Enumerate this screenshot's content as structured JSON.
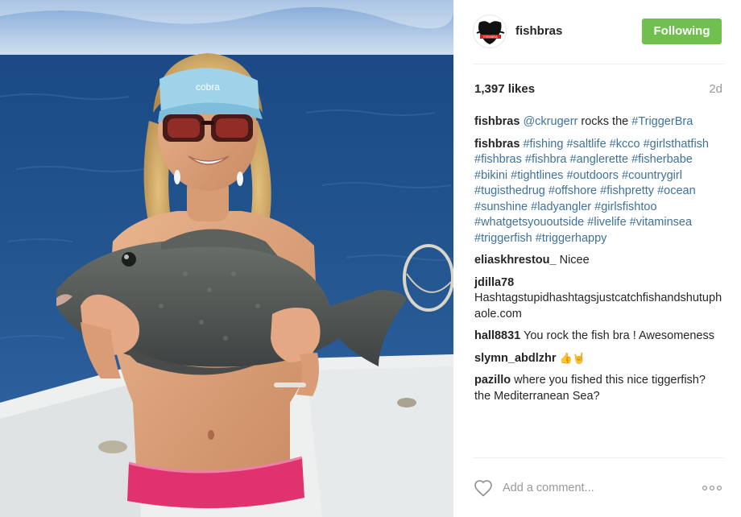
{
  "post": {
    "username": "fishbras",
    "follow_button": "Following",
    "likes": "1,397 likes",
    "time": "2d",
    "caption": {
      "user": "fishbras",
      "parts": [
        {
          "text": "@ckrugerr",
          "link": true
        },
        {
          "text": " rocks the ",
          "link": false
        },
        {
          "text": "#TriggerBra",
          "link": true
        }
      ]
    },
    "hashtag_comment": {
      "user": "fishbras",
      "tags": [
        "#fishing",
        "#saltlife",
        "#kcco",
        "#girlsthatfish",
        "#fishbras",
        "#fishbra",
        "#anglerette",
        "#fisherbabe",
        "#bikini",
        "#tightlines",
        "#outdoors",
        "#countrygirl",
        "#tugisthedrug",
        "#offshore",
        "#fishpretty",
        "#ocean",
        "#sunshine",
        "#ladyangler",
        "#girlsfishtoo",
        "#whatgetsyououtside",
        "#livelife",
        "#vitaminsea",
        "#triggerfish",
        "#triggerhappy"
      ]
    },
    "comments": [
      {
        "user": "eliaskhrestou_",
        "text": "Nicee"
      },
      {
        "user": "jdilla78",
        "text": "Hashtagstupidhashtagsjustcatchfishandshutuphaole.com"
      },
      {
        "user": "hall8831",
        "text": "You rock the fish bra ! Awesomeness"
      },
      {
        "user": "slymn_abdlzhr",
        "text": "👍🤘",
        "emoji": true
      },
      {
        "user": "pazillo",
        "text": "where you fished this nice tiggerfish? the Mediterranean Sea?"
      }
    ],
    "add_comment_placeholder": "Add a comment...",
    "icons": {
      "like": "heart-icon",
      "more": "more-options-icon",
      "avatar": "fishbras-logo"
    },
    "colors": {
      "follow": "#70c050",
      "link": "#3f729b",
      "muted": "#999999"
    }
  }
}
